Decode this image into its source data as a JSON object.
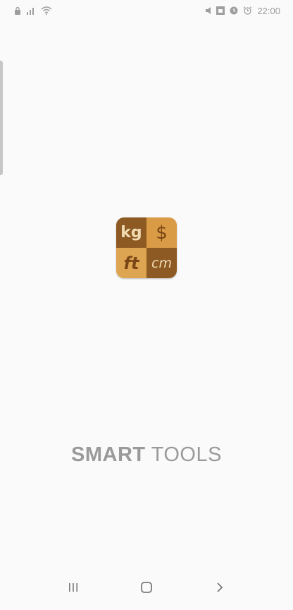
{
  "status_bar": {
    "time": "22:00",
    "left_icons": [
      "lock-icon",
      "signal-bars-icon",
      "wifi-icon"
    ],
    "right_icons": [
      "mute-icon",
      "sim-icon",
      "sync-icon",
      "alarm-icon"
    ]
  },
  "logo": {
    "cells": [
      "kg",
      "$",
      "ft",
      "cm"
    ]
  },
  "brand": {
    "word1": "SMART",
    "word2": "TOOLS"
  },
  "nav_bar": {
    "icons": [
      "recent-apps-icon",
      "home-icon",
      "back-icon"
    ]
  },
  "colors": {
    "background": "#fafafa",
    "logo_dark": "#8d5a23",
    "logo_light": "#dda451",
    "brand_text": "#9a9a9a"
  }
}
